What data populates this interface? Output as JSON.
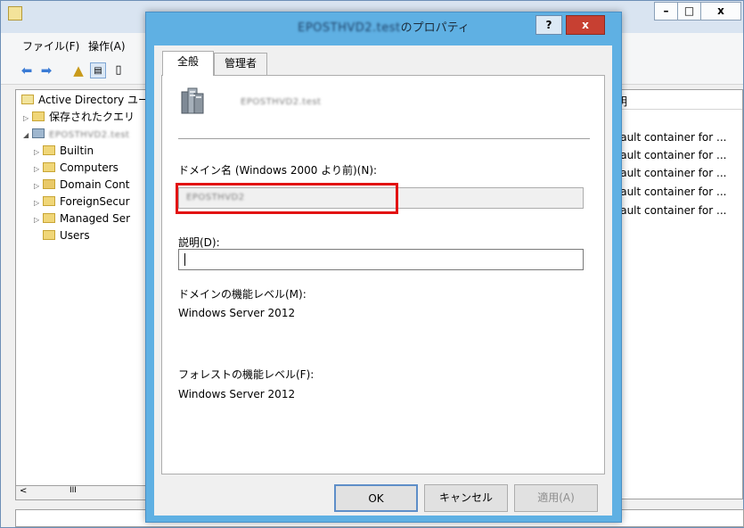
{
  "main_window": {
    "minimize": "–",
    "maximize": "□",
    "close": "x",
    "menu": [
      "ファイル(F)",
      "操作(A)"
    ],
    "tree": [
      {
        "label": "Active Directory ユー",
        "level": 0
      },
      {
        "label": "保存されたクエリ",
        "level": 1
      },
      {
        "label": "EPOSTHVD2.test",
        "level": 1
      },
      {
        "label": "Builtin",
        "level": 2
      },
      {
        "label": "Computers",
        "level": 2
      },
      {
        "label": "Domain Cont",
        "level": 2
      },
      {
        "label": "ForeignSecur",
        "level": 2
      },
      {
        "label": "Managed Ser",
        "level": 2
      },
      {
        "label": "Users",
        "level": 2
      }
    ],
    "scroll_thumb": "III",
    "right_header": "明",
    "right_rows": [
      "fault container for ...",
      "fault container for ...",
      "fault container for ...",
      "fault container for ...",
      "fault container for ..."
    ]
  },
  "dialog": {
    "title_blur": "EPOSTHVD2.test",
    "title_suffix": "のプロパティ",
    "help": "?",
    "close": "x",
    "tabs": [
      "全般",
      "管理者"
    ],
    "domain_name": "EPOSTHVD2.test",
    "netbios_label": "ドメイン名 (Windows 2000 より前)(N):",
    "netbios_value": "EPOSTHVD2",
    "description_label": "説明(D):",
    "description_value": "",
    "domain_level_label": "ドメインの機能レベル(M):",
    "domain_level_value": "Windows Server 2012",
    "forest_level_label": "フォレストの機能レベル(F):",
    "forest_level_value": "Windows Server 2012",
    "ok": "OK",
    "cancel": "キャンセル",
    "apply": "適用(A)"
  },
  "colors": {
    "dialog_border": "#5fb0e3",
    "highlight": "#e21212"
  }
}
